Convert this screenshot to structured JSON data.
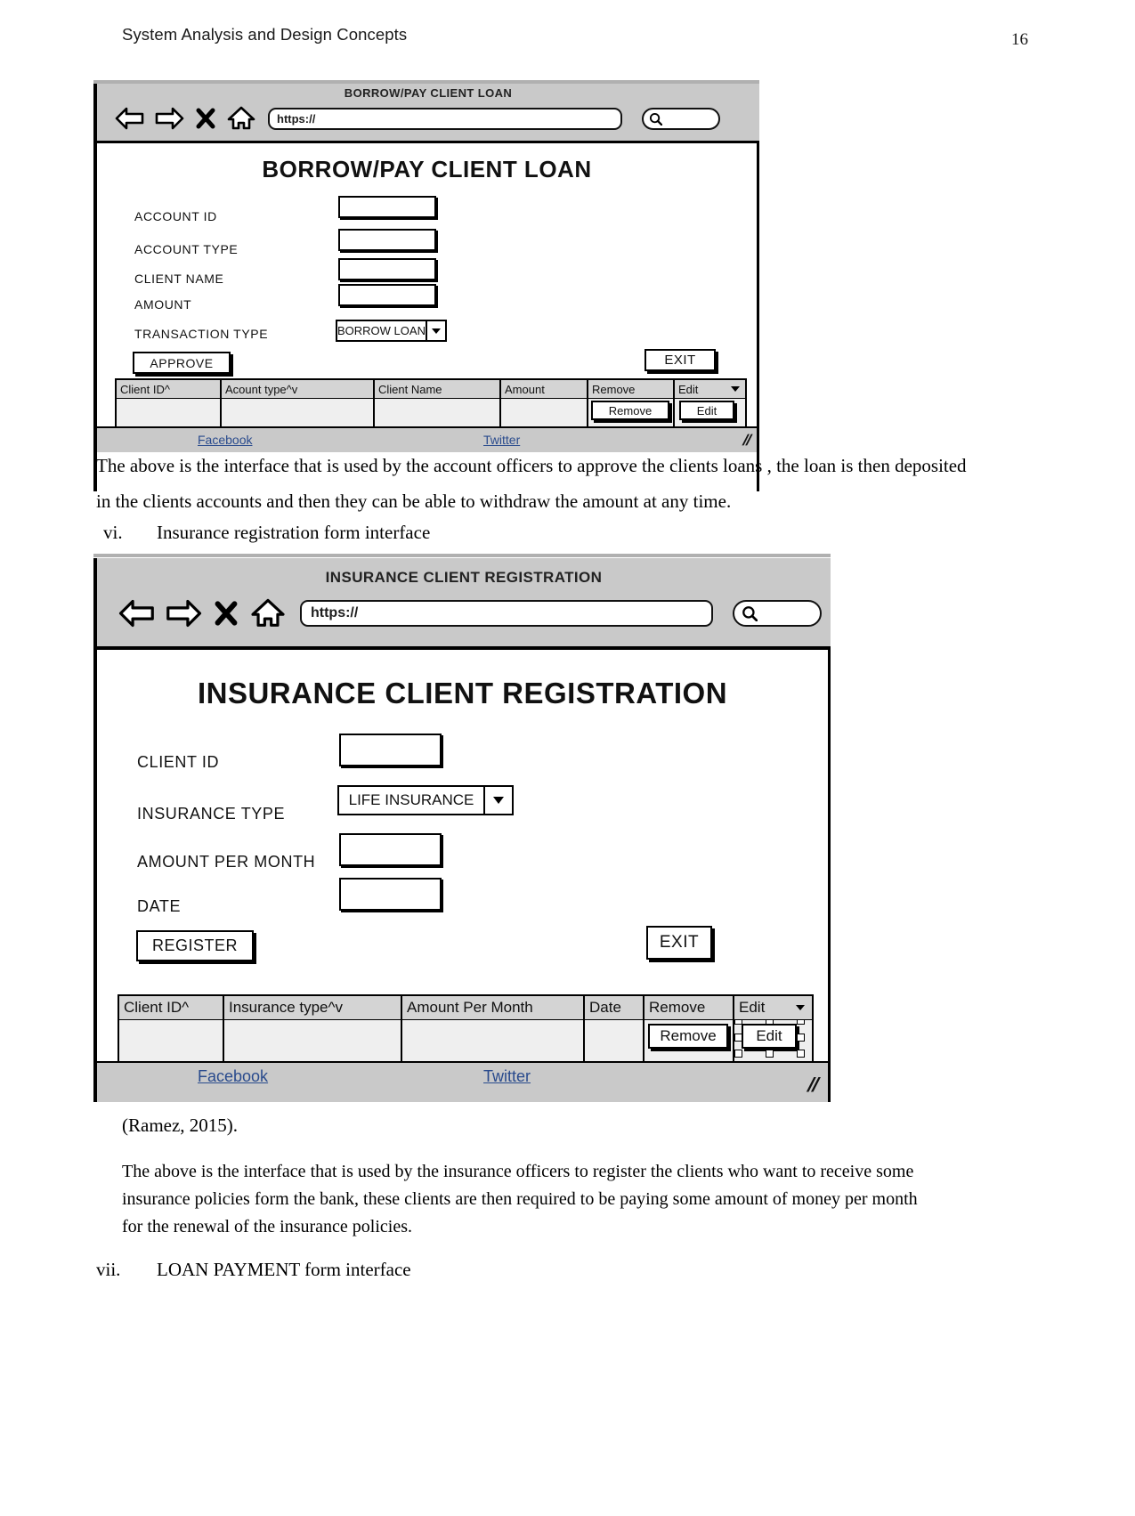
{
  "page": {
    "running_title": "System Analysis and Design Concepts",
    "number": "16"
  },
  "mockup1": {
    "chrome_title": "BORROW/PAY CLIENT LOAN",
    "url_value": "https://",
    "icons": {
      "back": "back-arrow-icon",
      "forward": "forward-arrow-icon",
      "close": "close-x-icon",
      "home": "home-icon",
      "search": "search-icon"
    },
    "form_title": "BORROW/PAY CLIENT LOAN",
    "fields": [
      {
        "label": "ACCOUNT ID",
        "value": ""
      },
      {
        "label": "ACCOUNT TYPE",
        "value": ""
      },
      {
        "label": "CLIENT NAME",
        "value": ""
      },
      {
        "label": "AMOUNT",
        "value": ""
      }
    ],
    "select": {
      "label": "TRANSACTION TYPE",
      "value": "BORROW LOAN"
    },
    "buttons": {
      "primary": "APPROVE",
      "exit": "EXIT"
    },
    "grid": {
      "columns": [
        "Client ID^",
        "Acount type^v",
        "Client Name",
        "Amount",
        "Remove",
        "Edit"
      ],
      "row_buttons": {
        "remove": "Remove",
        "edit": "Edit"
      }
    },
    "footer": {
      "facebook": "Facebook",
      "twitter": "Twitter",
      "grip": "//"
    }
  },
  "paragraph1": "The above is the interface that is used by the account officers to approve the clients loans , the loan is then deposited in the clients accounts and then they can be able to withdraw the amount at any time.",
  "section_vi": {
    "numeral": "vi.",
    "text": "Insurance registration form interface"
  },
  "mockup2": {
    "chrome_title": "INSURANCE CLIENT REGISTRATION",
    "url_value": "https://",
    "icons": {
      "back": "back-arrow-icon",
      "forward": "forward-arrow-icon",
      "close": "close-x-icon",
      "home": "home-icon",
      "search": "search-icon"
    },
    "form_title": "INSURANCE CLIENT REGISTRATION",
    "fields": [
      {
        "label": "CLIENT ID",
        "value": ""
      },
      {
        "label": "AMOUNT PER MONTH",
        "value": ""
      },
      {
        "label": "DATE",
        "value": ""
      }
    ],
    "select": {
      "label": "INSURANCE TYPE",
      "value": "LIFE INSURANCE"
    },
    "buttons": {
      "primary": "REGISTER",
      "exit": "EXIT"
    },
    "grid": {
      "columns": [
        "Client ID^",
        "Insurance type^v",
        "Amount Per Month",
        "Date",
        "Remove",
        "Edit"
      ],
      "row_buttons": {
        "remove": "Remove",
        "edit": "Edit"
      }
    },
    "footer": {
      "facebook": "Facebook",
      "twitter": "Twitter",
      "grip": "//"
    }
  },
  "citation": "(Ramez, 2015).",
  "paragraph2": "The above is the interface that is used by the insurance officers to register the clients who want to receive some insurance policies form the bank, these clients are then required to be paying some amount of money per month for the renewal of the insurance policies.",
  "section_vii": {
    "numeral": "vii.",
    "text": "LOAN PAYMENT form interface"
  }
}
